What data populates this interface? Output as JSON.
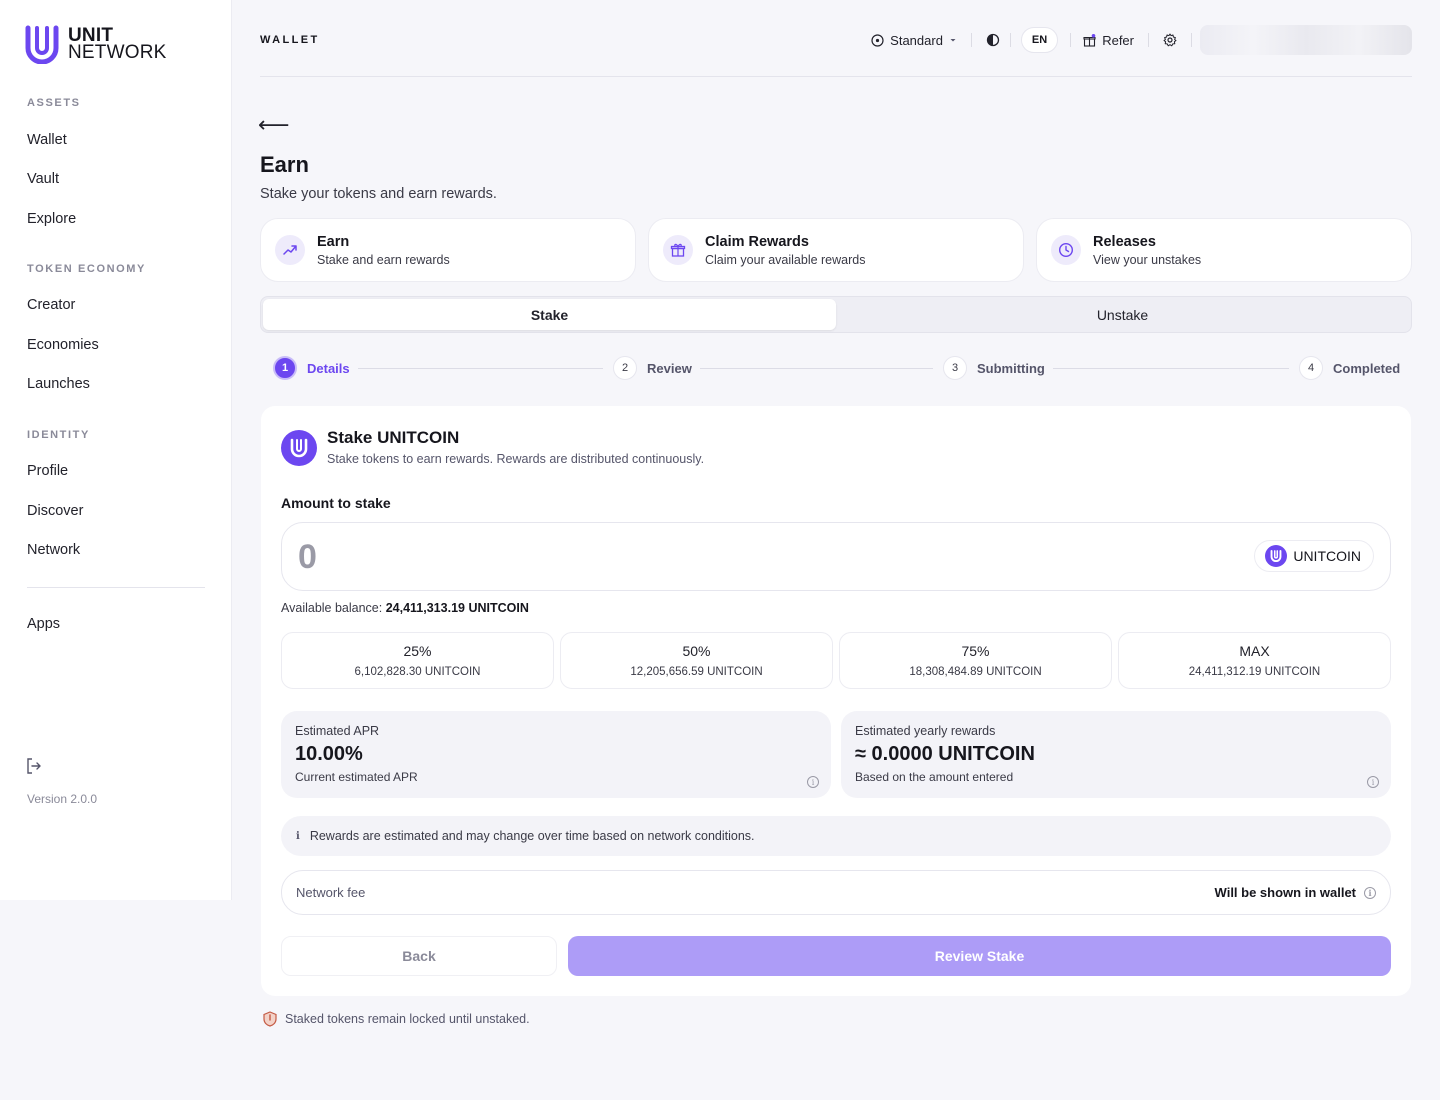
{
  "brand": {
    "line1": "UNIT",
    "line2": "NETWORK",
    "accent": "#6c47f0"
  },
  "sidebar": {
    "sections": [
      {
        "title": "ASSETS",
        "items": [
          "Wallet",
          "Vault",
          "Explore"
        ]
      },
      {
        "title": "TOKEN ECONOMY",
        "items": [
          "Creator",
          "Economies",
          "Launches"
        ]
      },
      {
        "title": "IDENTITY",
        "items": [
          "Profile",
          "Discover",
          "Network"
        ]
      }
    ],
    "apps": "Apps",
    "version": "Version 2.0.0"
  },
  "header": {
    "title": "WALLET",
    "mode": "Standard",
    "lang": "EN",
    "refer": "Refer"
  },
  "page": {
    "title": "Earn",
    "subtitle": "Stake your tokens and earn rewards."
  },
  "cards": [
    {
      "title": "Earn",
      "sub": "Stake and earn rewards",
      "icon": "trending-up-icon"
    },
    {
      "title": "Claim Rewards",
      "sub": "Claim your available rewards",
      "icon": "gift-icon"
    },
    {
      "title": "Releases",
      "sub": "View your unstakes",
      "icon": "clock-icon"
    }
  ],
  "tabs": [
    "Stake",
    "Unstake"
  ],
  "steps": [
    {
      "num": "1",
      "label": "Details"
    },
    {
      "num": "2",
      "label": "Review"
    },
    {
      "num": "3",
      "label": "Submitting"
    },
    {
      "num": "4",
      "label": "Completed"
    }
  ],
  "stake": {
    "title": "Stake UNITCOIN",
    "subtitle": "Stake tokens to earn rewards. Rewards are distributed continuously.",
    "amount_label": "Amount to stake",
    "amount_placeholder": "0",
    "token": "UNITCOIN",
    "balance_label": "Available balance:",
    "balance_value": "24,411,313.19 UNITCOIN",
    "presets": [
      {
        "label": "25%",
        "value": "6,102,828.30 UNITCOIN"
      },
      {
        "label": "50%",
        "value": "12,205,656.59 UNITCOIN"
      },
      {
        "label": "75%",
        "value": "18,308,484.89 UNITCOIN"
      },
      {
        "label": "MAX",
        "value": "24,411,312.19 UNITCOIN"
      }
    ],
    "apr": {
      "label": "Estimated APR",
      "value": "10.00%",
      "sub": "Current estimated APR"
    },
    "yearly": {
      "label": "Estimated yearly rewards",
      "value": "≈ 0.0000 UNITCOIN",
      "sub": "Based on the amount entered"
    },
    "notice": "Rewards are estimated and may change over time based on network conditions.",
    "fee_label": "Network fee",
    "fee_value": "Will be shown in wallet",
    "back": "Back",
    "review": "Review Stake"
  },
  "footer_note": "Staked tokens remain locked until unstaked."
}
